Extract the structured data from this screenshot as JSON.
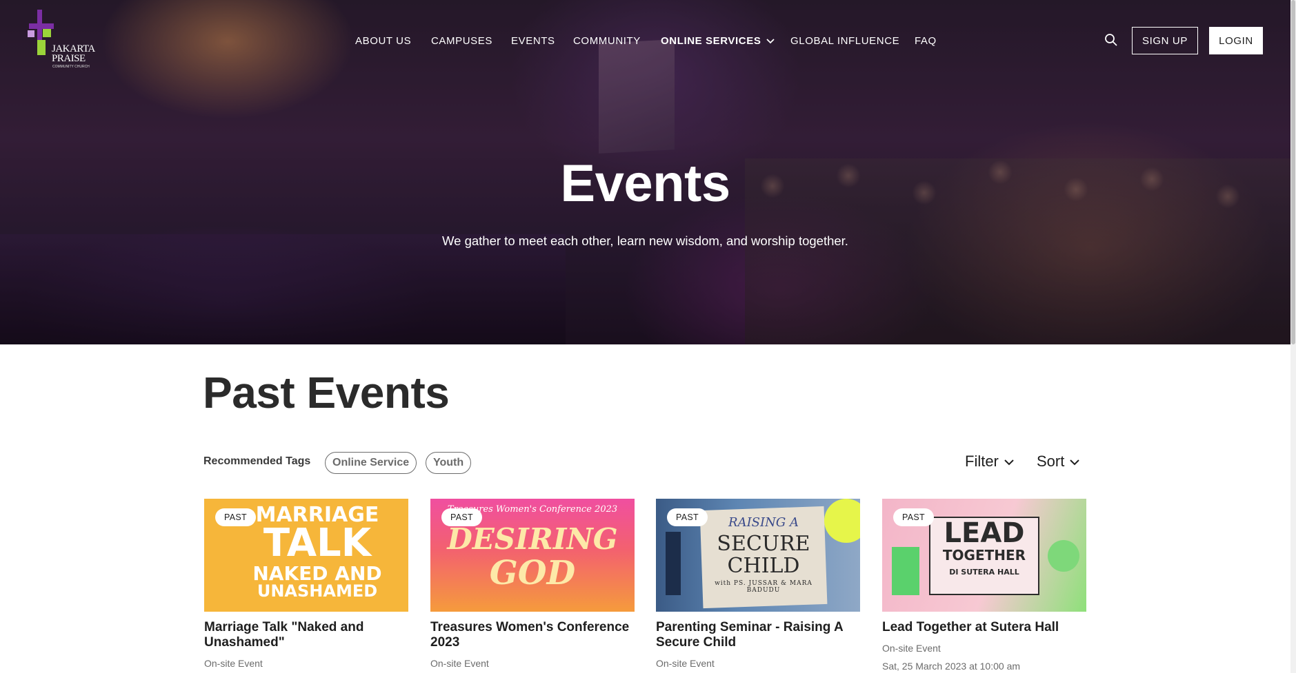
{
  "brand": {
    "logo_line1": "JAKARTA",
    "logo_line2": "PRAISE",
    "logo_line3": "COMMUNITY CHURCH",
    "accent_purple": "#7b2ea3",
    "accent_green": "#9bd43a"
  },
  "nav": {
    "items": [
      {
        "label": "ABOUT US"
      },
      {
        "label": "CAMPUSES"
      },
      {
        "label": "EVENTS"
      },
      {
        "label": "COMMUNITY"
      },
      {
        "label": "ONLINE SERVICES",
        "has_dropdown": true
      },
      {
        "label": "GLOBAL INFLUENCE"
      },
      {
        "label": "FAQ"
      }
    ],
    "search_icon": "search-icon",
    "signup_label": "SIGN UP",
    "login_label": "LOGIN"
  },
  "hero": {
    "title": "Events",
    "subtitle": "We gather to meet each other, learn new wisdom, and worship together."
  },
  "section": {
    "title": "Past Events",
    "tags_label": "Recommended Tags",
    "tags": [
      "Online Service",
      "Youth"
    ],
    "filter_label": "Filter",
    "sort_label": "Sort"
  },
  "cards": [
    {
      "badge": "PAST",
      "title": "Marriage Talk \"Naked and Unashamed\"",
      "type": "On-site Event",
      "date": "",
      "thumb": {
        "line1": "MARRIAGE",
        "line2": "TALK",
        "line3": "NAKED AND",
        "line4": "UNASHAMED",
        "bg": "#f6b63a"
      }
    },
    {
      "badge": "PAST",
      "title": "Treasures Women's Conference 2023",
      "type": "On-site Event",
      "date": "",
      "thumb": {
        "line1": "Treasures Women's Conference 2023",
        "line2": "DESIRING",
        "line3": "GOD"
      }
    },
    {
      "badge": "PAST",
      "title": "Parenting Seminar - Raising A Secure Child",
      "type": "On-site Event",
      "date": "",
      "thumb": {
        "line1": "RAISING A",
        "line2": "SECURE",
        "line3": "CHILD",
        "line4": "with PS. JUSSAR & MARA BADUDU"
      }
    },
    {
      "badge": "PAST",
      "title": "Lead Together at Sutera Hall",
      "type": "On-site Event",
      "date": "Sat, 25 March 2023 at 10:00 am",
      "thumb": {
        "line1": "LEAD",
        "line2": "TOGETHER",
        "line3": "DI SUTERA HALL"
      }
    }
  ]
}
